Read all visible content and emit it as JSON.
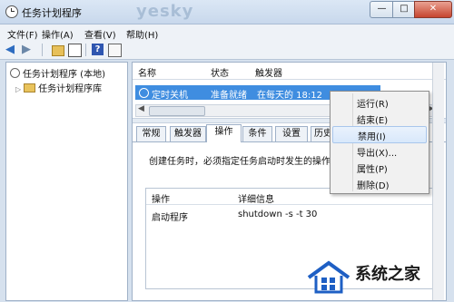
{
  "window": {
    "title": "任务计划程序",
    "watermark": "yesky",
    "min_glyph": "—",
    "max_glyph": "□",
    "close_glyph": "✕"
  },
  "menu": [
    "文件(F)",
    "操作(A)",
    "查看(V)",
    "帮助(H)"
  ],
  "toolbar": {
    "help_glyph": "?"
  },
  "tree": {
    "root": "任务计划程序 (本地)",
    "library": "任务计划程序库",
    "expander": "▷"
  },
  "task_list": {
    "columns": [
      "名称",
      "状态",
      "触发器"
    ],
    "selected": {
      "name": "定时关机",
      "status": "准备就绪",
      "trigger": "在每天的 18:12"
    }
  },
  "tabs": [
    "常规",
    "触发器",
    "操作",
    "条件",
    "设置",
    "历史"
  ],
  "active_tab": "操作",
  "actions_panel": {
    "description": "创建任务时，必须指定任务启动时发生的操作。",
    "columns": [
      "操作",
      "详细信息"
    ],
    "rows": [
      {
        "action": "启动程序",
        "details": "shutdown -s -t 30"
      }
    ]
  },
  "context_menu": [
    "运行(R)",
    "结束(E)",
    "禁用(I)",
    "导出(X)...",
    "属性(P)",
    "删除(D)"
  ],
  "context_menu_highlighted": "禁用(I)",
  "logo": {
    "text": "系统之家"
  },
  "colors": {
    "selection": "#3f8de0",
    "close_button": "#c6452f",
    "titlebar": "#c8d8ec"
  }
}
